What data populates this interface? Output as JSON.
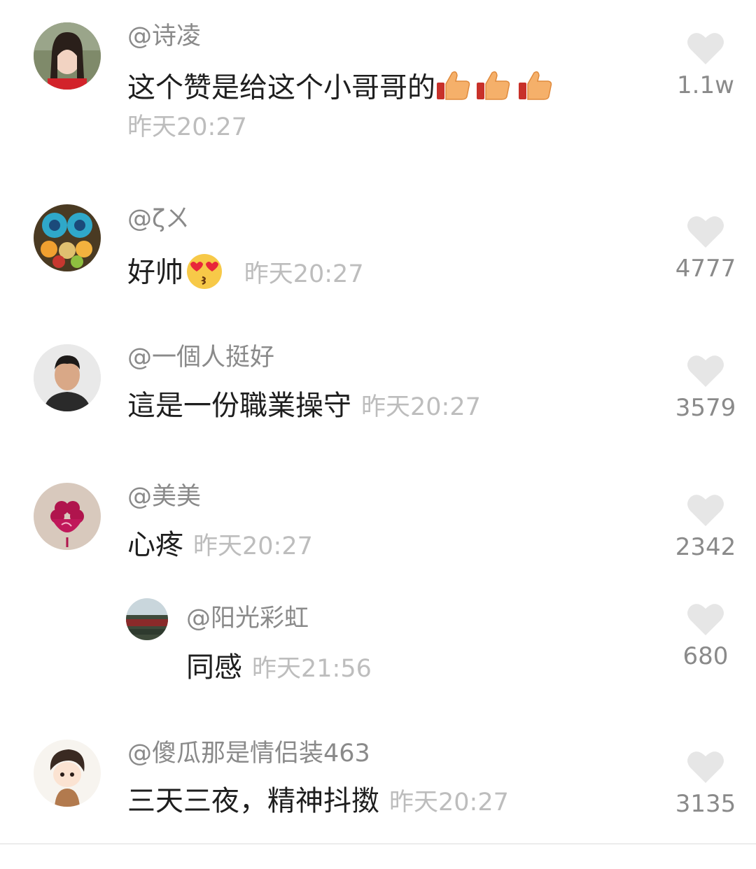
{
  "comments": [
    {
      "username": "@诗凌",
      "text": "这个赞是给这个小哥哥的",
      "emoji": [
        "thumbs-up",
        "thumbs-up",
        "thumbs-up"
      ],
      "time": "昨天20:27",
      "likes": "1.1w",
      "avatar": "woman-photo-avatar"
    },
    {
      "username": "@ζㄨ",
      "text": "好帅",
      "emoji": [
        "kissing-heart-eyes"
      ],
      "time": "昨天20:27",
      "likes": "4777",
      "avatar": "fruit-basket-avatar"
    },
    {
      "username": "@一個人挺好",
      "text": "這是一份職業操守",
      "time": "昨天20:27",
      "likes": "3579",
      "avatar": "man-photo-avatar"
    },
    {
      "username": "@美美",
      "text": "心疼",
      "time": "昨天20:27",
      "likes": "2342",
      "avatar": "pink-flower-avatar"
    },
    {
      "username": "@阳光彩虹",
      "text": "同感",
      "time": "昨天21:56",
      "likes": "680",
      "avatar": "crowd-photo-avatar",
      "is_reply": true
    },
    {
      "username": "@傻瓜那是情侣装463",
      "text": "三天三夜，精神抖擞",
      "time": "昨天20:27",
      "likes": "3135",
      "avatar": "cartoon-boy-avatar"
    }
  ],
  "colors": {
    "username": "#8a8a8a",
    "text": "#1e1e1e",
    "time": "#bdbdbd",
    "heart": "#e6e6e6"
  }
}
